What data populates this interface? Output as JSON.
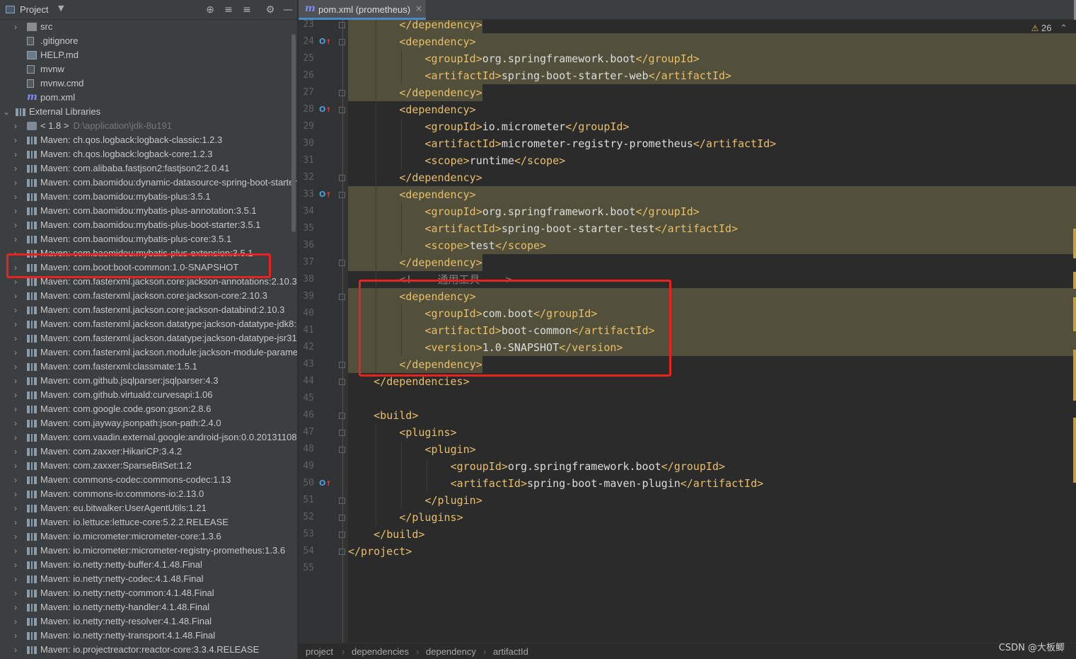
{
  "project_panel": {
    "title": "Project",
    "caret": "▼",
    "header_icons": [
      "crosshair-icon",
      "expand-all-icon",
      "collapse-all-icon",
      "gear-icon",
      "minimize-icon"
    ],
    "header_glyphs": [
      "⊕",
      "≡",
      "≡",
      "⚙",
      "—"
    ],
    "tree": [
      {
        "label": "src",
        "icon": "folder-icon",
        "depth": 1,
        "arrow": "›"
      },
      {
        "label": ".gitignore",
        "icon": "file-icon",
        "depth": 1,
        "arrow": ""
      },
      {
        "label": "HELP.md",
        "icon": "markdown-icon",
        "depth": 1,
        "arrow": ""
      },
      {
        "label": "mvnw",
        "icon": "terminal-icon",
        "depth": 1,
        "arrow": ""
      },
      {
        "label": "mvnw.cmd",
        "icon": "file-icon",
        "depth": 1,
        "arrow": ""
      },
      {
        "label": "pom.xml",
        "icon": "maven-icon",
        "depth": 1,
        "arrow": ""
      },
      {
        "label": "External Libraries",
        "icon": "library-icon",
        "depth": 0,
        "arrow": "⌄"
      },
      {
        "label": "< 1.8 >",
        "sub": "D:\\application\\jdk-8u191",
        "icon": "jdk-icon",
        "depth": 1,
        "arrow": "›"
      },
      {
        "label": "Maven: ch.qos.logback:logback-classic:1.2.3",
        "icon": "library-icon",
        "depth": 1,
        "arrow": "›"
      },
      {
        "label": "Maven: ch.qos.logback:logback-core:1.2.3",
        "icon": "library-icon",
        "depth": 1,
        "arrow": "›"
      },
      {
        "label": "Maven: com.alibaba.fastjson2:fastjson2:2.0.41",
        "icon": "library-icon",
        "depth": 1,
        "arrow": "›"
      },
      {
        "label": "Maven: com.baomidou:dynamic-datasource-spring-boot-starter",
        "icon": "library-icon",
        "depth": 1,
        "arrow": "›"
      },
      {
        "label": "Maven: com.baomidou:mybatis-plus:3.5.1",
        "icon": "library-icon",
        "depth": 1,
        "arrow": "›"
      },
      {
        "label": "Maven: com.baomidou:mybatis-plus-annotation:3.5.1",
        "icon": "library-icon",
        "depth": 1,
        "arrow": "›"
      },
      {
        "label": "Maven: com.baomidou:mybatis-plus-boot-starter:3.5.1",
        "icon": "library-icon",
        "depth": 1,
        "arrow": "›"
      },
      {
        "label": "Maven: com.baomidou:mybatis-plus-core:3.5.1",
        "icon": "library-icon",
        "depth": 1,
        "arrow": "›"
      },
      {
        "label": "Maven: com.baomidou:mybatis-plus-extension:3.5.1",
        "icon": "library-icon",
        "depth": 1,
        "arrow": "›"
      },
      {
        "label": "Maven: com.boot:boot-common:1.0-SNAPSHOT",
        "icon": "library-icon",
        "depth": 1,
        "arrow": "›"
      },
      {
        "label": "Maven: com.fasterxml.jackson.core:jackson-annotations:2.10.3",
        "icon": "library-icon",
        "depth": 1,
        "arrow": "›"
      },
      {
        "label": "Maven: com.fasterxml.jackson.core:jackson-core:2.10.3",
        "icon": "library-icon",
        "depth": 1,
        "arrow": "›"
      },
      {
        "label": "Maven: com.fasterxml.jackson.core:jackson-databind:2.10.3",
        "icon": "library-icon",
        "depth": 1,
        "arrow": "›"
      },
      {
        "label": "Maven: com.fasterxml.jackson.datatype:jackson-datatype-jdk8:2",
        "icon": "library-icon",
        "depth": 1,
        "arrow": "›"
      },
      {
        "label": "Maven: com.fasterxml.jackson.datatype:jackson-datatype-jsr310",
        "icon": "library-icon",
        "depth": 1,
        "arrow": "›"
      },
      {
        "label": "Maven: com.fasterxml.jackson.module:jackson-module-parameter",
        "icon": "library-icon",
        "depth": 1,
        "arrow": "›"
      },
      {
        "label": "Maven: com.fasterxml:classmate:1.5.1",
        "icon": "library-icon",
        "depth": 1,
        "arrow": "›"
      },
      {
        "label": "Maven: com.github.jsqlparser:jsqlparser:4.3",
        "icon": "library-icon",
        "depth": 1,
        "arrow": "›"
      },
      {
        "label": "Maven: com.github.virtuald:curvesapi:1.06",
        "icon": "library-icon",
        "depth": 1,
        "arrow": "›"
      },
      {
        "label": "Maven: com.google.code.gson:gson:2.8.6",
        "icon": "library-icon",
        "depth": 1,
        "arrow": "›"
      },
      {
        "label": "Maven: com.jayway.jsonpath:json-path:2.4.0",
        "icon": "library-icon",
        "depth": 1,
        "arrow": "›"
      },
      {
        "label": "Maven: com.vaadin.external.google:android-json:0.0.20131108",
        "icon": "library-icon",
        "depth": 1,
        "arrow": "›"
      },
      {
        "label": "Maven: com.zaxxer:HikariCP:3.4.2",
        "icon": "library-icon",
        "depth": 1,
        "arrow": "›"
      },
      {
        "label": "Maven: com.zaxxer:SparseBitSet:1.2",
        "icon": "library-icon",
        "depth": 1,
        "arrow": "›"
      },
      {
        "label": "Maven: commons-codec:commons-codec:1.13",
        "icon": "library-icon",
        "depth": 1,
        "arrow": "›"
      },
      {
        "label": "Maven: commons-io:commons-io:2.13.0",
        "icon": "library-icon",
        "depth": 1,
        "arrow": "›"
      },
      {
        "label": "Maven: eu.bitwalker:UserAgentUtils:1.21",
        "icon": "library-icon",
        "depth": 1,
        "arrow": "›"
      },
      {
        "label": "Maven: io.lettuce:lettuce-core:5.2.2.RELEASE",
        "icon": "library-icon",
        "depth": 1,
        "arrow": "›"
      },
      {
        "label": "Maven: io.micrometer:micrometer-core:1.3.6",
        "icon": "library-icon",
        "depth": 1,
        "arrow": "›"
      },
      {
        "label": "Maven: io.micrometer:micrometer-registry-prometheus:1.3.6",
        "icon": "library-icon",
        "depth": 1,
        "arrow": "›"
      },
      {
        "label": "Maven: io.netty:netty-buffer:4.1.48.Final",
        "icon": "library-icon",
        "depth": 1,
        "arrow": "›"
      },
      {
        "label": "Maven: io.netty:netty-codec:4.1.48.Final",
        "icon": "library-icon",
        "depth": 1,
        "arrow": "›"
      },
      {
        "label": "Maven: io.netty:netty-common:4.1.48.Final",
        "icon": "library-icon",
        "depth": 1,
        "arrow": "›"
      },
      {
        "label": "Maven: io.netty:netty-handler:4.1.48.Final",
        "icon": "library-icon",
        "depth": 1,
        "arrow": "›"
      },
      {
        "label": "Maven: io.netty:netty-resolver:4.1.48.Final",
        "icon": "library-icon",
        "depth": 1,
        "arrow": "›"
      },
      {
        "label": "Maven: io.netty:netty-transport:4.1.48.Final",
        "icon": "library-icon",
        "depth": 1,
        "arrow": "›"
      },
      {
        "label": "Maven: io.projectreactor:reactor-core:3.3.4.RELEASE",
        "icon": "library-icon",
        "depth": 1,
        "arrow": "›"
      }
    ],
    "highlighted_item": "Maven: com.boot:boot-common:1.0-SNAPSHOT"
  },
  "editor": {
    "tab": {
      "icon_glyph": "m",
      "label": "pom.xml (prometheus)",
      "close": "×"
    },
    "warning": {
      "icon": "⚠",
      "count": "26",
      "nav": "⌃"
    },
    "highlight_color": "#52503a",
    "annotation_color": "#e8231f",
    "lines": [
      {
        "n": "23",
        "indent": 2,
        "parts": [
          [
            "tag",
            "</dependency>"
          ]
        ],
        "hl": "partial",
        "fold": true
      },
      {
        "n": "24",
        "indent": 2,
        "parts": [
          [
            "tag",
            "<dependency>"
          ]
        ],
        "hl": "full",
        "mark": true,
        "fold": true
      },
      {
        "n": "25",
        "indent": 3,
        "parts": [
          [
            "tag",
            "<groupId>"
          ],
          [
            "txt",
            "org.springframework.boot"
          ],
          [
            "tag",
            "</groupId>"
          ]
        ],
        "hl": "full"
      },
      {
        "n": "26",
        "indent": 3,
        "parts": [
          [
            "tag",
            "<artifactId>"
          ],
          [
            "txt",
            "spring-boot-starter-web"
          ],
          [
            "tag",
            "</artifactId>"
          ]
        ],
        "hl": "full"
      },
      {
        "n": "27",
        "indent": 2,
        "parts": [
          [
            "tag",
            "</dependency>"
          ]
        ],
        "hl": "partial",
        "fold": true
      },
      {
        "n": "28",
        "indent": 2,
        "parts": [
          [
            "tag",
            "<dependency>"
          ]
        ],
        "mark": true,
        "fold": true
      },
      {
        "n": "29",
        "indent": 3,
        "parts": [
          [
            "tag",
            "<groupId>"
          ],
          [
            "txt",
            "io.micrometer"
          ],
          [
            "tag",
            "</groupId>"
          ]
        ]
      },
      {
        "n": "30",
        "indent": 3,
        "parts": [
          [
            "tag",
            "<artifactId>"
          ],
          [
            "txt",
            "micrometer-registry-prometheus"
          ],
          [
            "tag",
            "</artifactId>"
          ]
        ]
      },
      {
        "n": "31",
        "indent": 3,
        "parts": [
          [
            "tag",
            "<scope>"
          ],
          [
            "txt",
            "runtime"
          ],
          [
            "tag",
            "</scope>"
          ]
        ]
      },
      {
        "n": "32",
        "indent": 2,
        "parts": [
          [
            "tag",
            "</dependency>"
          ]
        ],
        "fold": true
      },
      {
        "n": "33",
        "indent": 2,
        "parts": [
          [
            "tag",
            "<dependency>"
          ]
        ],
        "hl": "full",
        "mark": true,
        "fold": true
      },
      {
        "n": "34",
        "indent": 3,
        "parts": [
          [
            "tag",
            "<groupId>"
          ],
          [
            "txt",
            "org.springframework.boot"
          ],
          [
            "tag",
            "</groupId>"
          ]
        ],
        "hl": "full"
      },
      {
        "n": "35",
        "indent": 3,
        "parts": [
          [
            "tag",
            "<artifactId>"
          ],
          [
            "txt",
            "spring-boot-starter-test"
          ],
          [
            "tag",
            "</artifactId>"
          ]
        ],
        "hl": "full"
      },
      {
        "n": "36",
        "indent": 3,
        "parts": [
          [
            "tag",
            "<scope>"
          ],
          [
            "txt",
            "test"
          ],
          [
            "tag",
            "</scope>"
          ]
        ],
        "hl": "full"
      },
      {
        "n": "37",
        "indent": 2,
        "parts": [
          [
            "tag",
            "</dependency>"
          ]
        ],
        "hl": "partial",
        "fold": true
      },
      {
        "n": "38",
        "indent": 2,
        "parts": [
          [
            "cmt",
            "<!--  通用工具  -->"
          ]
        ]
      },
      {
        "n": "39",
        "indent": 2,
        "parts": [
          [
            "tag",
            "<dependency>"
          ]
        ],
        "hl": "full",
        "fold": true
      },
      {
        "n": "40",
        "indent": 3,
        "parts": [
          [
            "tag",
            "<groupId>"
          ],
          [
            "txt",
            "com.boot"
          ],
          [
            "tag",
            "</groupId>"
          ]
        ],
        "hl": "full"
      },
      {
        "n": "41",
        "indent": 3,
        "parts": [
          [
            "tag",
            "<artifactId>"
          ],
          [
            "txt",
            "boot-common"
          ],
          [
            "tag",
            "</artifactId>"
          ]
        ],
        "hl": "full",
        "caret": true
      },
      {
        "n": "42",
        "indent": 3,
        "parts": [
          [
            "tag",
            "<version>"
          ],
          [
            "txt",
            "1.0-SNAPSHOT"
          ],
          [
            "tag",
            "</version>"
          ]
        ],
        "hl": "full"
      },
      {
        "n": "43",
        "indent": 2,
        "parts": [
          [
            "tag",
            "</dependency>"
          ]
        ],
        "hl": "partial",
        "fold": true
      },
      {
        "n": "44",
        "indent": 1,
        "parts": [
          [
            "tag",
            "</dependencies>"
          ]
        ],
        "fold": true
      },
      {
        "n": "45",
        "indent": 0,
        "parts": []
      },
      {
        "n": "46",
        "indent": 1,
        "parts": [
          [
            "tag",
            "<build>"
          ]
        ],
        "fold": true
      },
      {
        "n": "47",
        "indent": 2,
        "parts": [
          [
            "tag",
            "<plugins>"
          ]
        ],
        "fold": true
      },
      {
        "n": "48",
        "indent": 3,
        "parts": [
          [
            "tag",
            "<plugin>"
          ]
        ],
        "fold": true
      },
      {
        "n": "49",
        "indent": 4,
        "parts": [
          [
            "tag",
            "<groupId>"
          ],
          [
            "txt",
            "org.springframework.boot"
          ],
          [
            "tag",
            "</groupId>"
          ]
        ]
      },
      {
        "n": "50",
        "indent": 4,
        "parts": [
          [
            "tag",
            "<artifactId>"
          ],
          [
            "txt",
            "spring-boot-maven-plugin"
          ],
          [
            "tag",
            "</artifactId>"
          ]
        ],
        "mark": true
      },
      {
        "n": "51",
        "indent": 3,
        "parts": [
          [
            "tag",
            "</plugin>"
          ]
        ],
        "fold": true
      },
      {
        "n": "52",
        "indent": 2,
        "parts": [
          [
            "tag",
            "</plugins>"
          ]
        ],
        "fold": true
      },
      {
        "n": "53",
        "indent": 1,
        "parts": [
          [
            "tag",
            "</build>"
          ]
        ],
        "fold": true
      },
      {
        "n": "54",
        "indent": 0,
        "parts": [
          [
            "tag",
            "</project>"
          ]
        ],
        "fold": true
      },
      {
        "n": "55",
        "indent": 0,
        "parts": []
      }
    ]
  },
  "breadcrumbs": [
    "project",
    "dependencies",
    "dependency",
    "artifactId"
  ],
  "watermark": "CSDN @大板鲫"
}
